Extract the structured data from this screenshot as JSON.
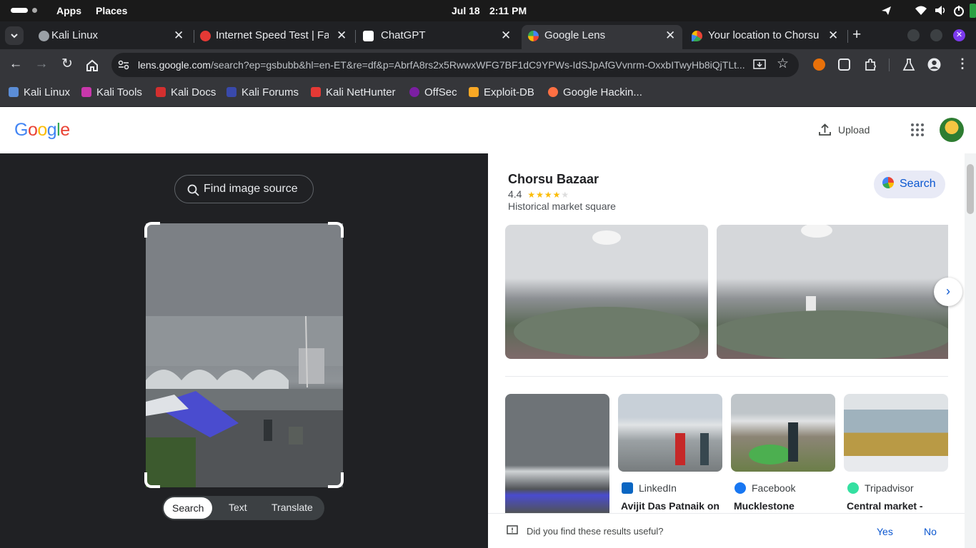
{
  "system_bar": {
    "apps": "Apps",
    "places": "Places",
    "date": "Jul 18",
    "time": "2:11 PM"
  },
  "tabs": [
    {
      "title": "Kali Linux",
      "active": false
    },
    {
      "title": "Internet Speed Test | Fast",
      "active": false
    },
    {
      "title": "ChatGPT",
      "active": false
    },
    {
      "title": "Google Lens",
      "active": true
    },
    {
      "title": "Your location to Chorsu",
      "active": false
    }
  ],
  "address_bar": {
    "domain": "lens.google.com",
    "path": "/search?ep=gsbubb&hl=en-ET&re=df&p=AbrfA8rs2x5RwwxWFG7BF1dC9YPWs-IdSJpAfGVvnrm-OxxbITwyHb8iQjTLt..."
  },
  "bookmarks": [
    "Kali Linux",
    "Kali Tools",
    "Kali Docs",
    "Kali Forums",
    "Kali NetHunter",
    "OffSec",
    "Exploit-DB",
    "Google Hackin..."
  ],
  "header": {
    "logo": "Google",
    "upload": "Upload"
  },
  "lens": {
    "find_source": "Find image source",
    "modes": [
      "Search",
      "Text",
      "Translate"
    ]
  },
  "result": {
    "title": "Chorsu Bazaar",
    "rating": "4.4",
    "stars": 4.4,
    "subtitle": "Historical market square",
    "search_button": "Search"
  },
  "visual_matches": [
    {
      "source": "LinkedIn",
      "title": "Avijit Das Patnaik on"
    },
    {
      "source": "Facebook",
      "title": "Mucklestone"
    },
    {
      "source": "Tripadvisor",
      "title": "Central market -"
    }
  ],
  "feedback": {
    "question": "Did you find these results useful?",
    "yes": "Yes",
    "no": "No"
  },
  "colors": {
    "accent": "#1a73e8",
    "link": "#0b57d0",
    "pill_bg": "#e8eaf6"
  }
}
